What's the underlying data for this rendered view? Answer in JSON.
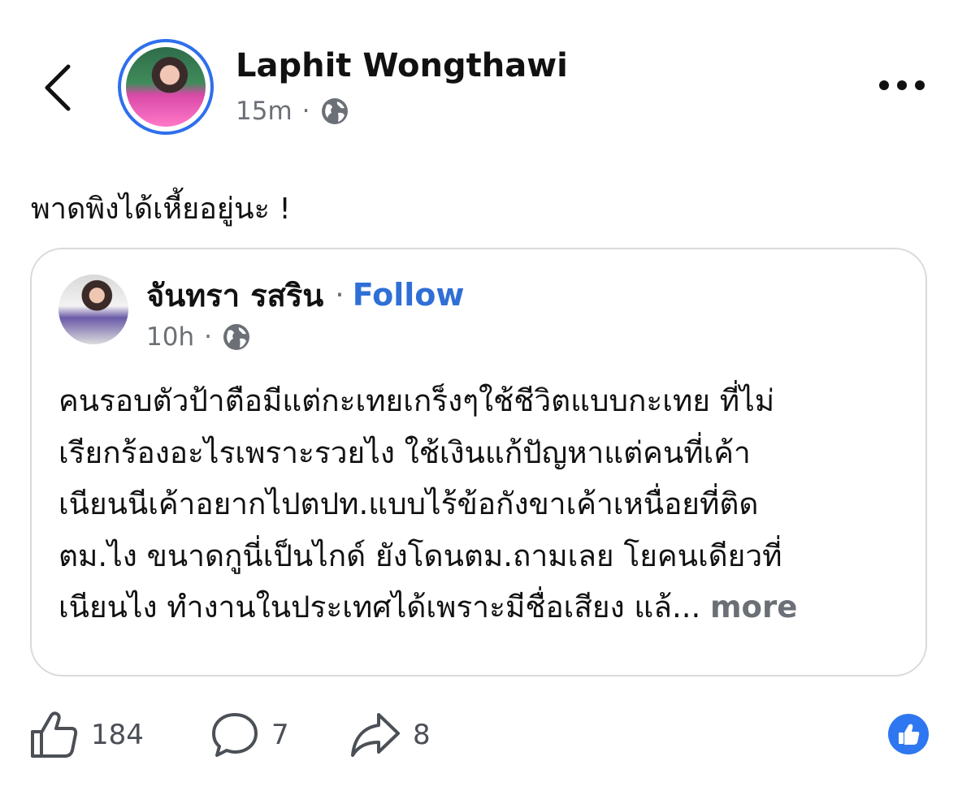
{
  "post": {
    "author": "Laphit Wongthawi",
    "time": "15m",
    "separator": "·",
    "privacy_icon": "globe-icon",
    "text": "พาดพิงได้เหี้ยอยู่นะ !"
  },
  "shared": {
    "author": "จันทรา รสริน",
    "separator": "·",
    "follow_label": "Follow",
    "time": "10h",
    "privacy_icon": "globe-icon",
    "lines": [
      "คนรอบตัวป้าตือมีแต่กะเทยเกร็งๆใช้ชีวิตแบบกะเทย ที่ไม่",
      "เรียกร้องอะไรเพราะรวยไง ใช้เงินแก้ปัญหาแต่คนที่เค้า",
      "เนียนนีเค้าอยากไปตปท.แบบไร้ข้อกังขาเค้าเหนื่อยที่ติด",
      "ตม.ไง ขนาดกูนี่เป็นไกด์ ยังโดนตม.ถามเลย โยคนเดียวที่",
      "เนียนไง ทำงานในประเทศได้เพราะมีชื่อเสียง แล้..."
    ],
    "more_label": "more"
  },
  "actions": {
    "likes": "184",
    "comments": "7",
    "shares": "8"
  },
  "colors": {
    "accent": "#2f6fd6",
    "avatar_ring": "#2f6fed",
    "muted": "#6b6f76",
    "reaction": "#2f77f0"
  }
}
